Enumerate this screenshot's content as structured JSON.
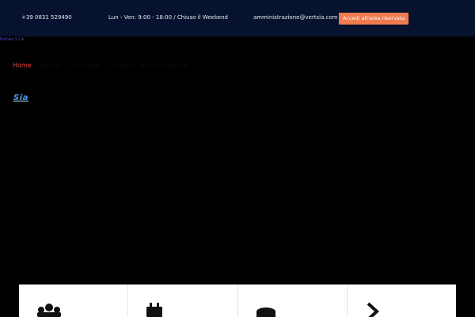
{
  "topbar": {
    "phone": "+39 0831 529490",
    "hours": "Lun - Ven: 9:00 - 18:00 / Chiuso il Weekend",
    "email": "amministrazione@vertsia.com",
    "login_label": "Accedi all'area riservata"
  },
  "portal_label": "Portale S.I.A.",
  "nav": {
    "items": [
      {
        "label": "Home",
        "active": true
      },
      {
        "label": "Servizi"
      },
      {
        "label": "Chi siamo"
      },
      {
        "label": "Contatti"
      },
      {
        "label": "Area Riservata"
      }
    ]
  },
  "logo": {
    "text": "Sia"
  },
  "cards": [
    {
      "icon": "group-icon"
    },
    {
      "icon": "calendar-icon"
    },
    {
      "icon": "coin-icon"
    },
    {
      "icon": "chevron-right-icon"
    }
  ],
  "colors": {
    "topbar_bg": "#07132e",
    "accent": "#f27a4f",
    "nav_active": "#e54b3a",
    "logo": "#4c9cf0"
  }
}
